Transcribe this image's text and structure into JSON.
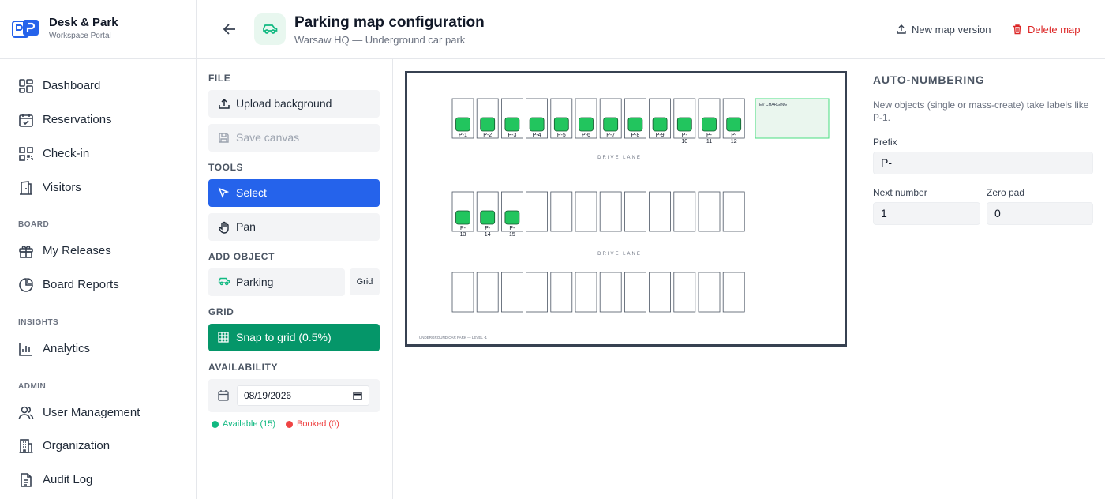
{
  "brand": {
    "name": "Desk & Park",
    "subtitle": "Workspace Portal"
  },
  "sidebar": {
    "items": [
      {
        "label": "Dashboard",
        "icon": "dashboard-icon"
      },
      {
        "label": "Reservations",
        "icon": "calendar-check-icon"
      },
      {
        "label": "Check-in",
        "icon": "qr-code-icon"
      },
      {
        "label": "Visitors",
        "icon": "door-icon"
      }
    ],
    "board_label": "BOARD",
    "board_items": [
      {
        "label": "My Releases",
        "icon": "gift-icon"
      },
      {
        "label": "Board Reports",
        "icon": "pie-chart-icon"
      }
    ],
    "insights_label": "INSIGHTS",
    "insights_items": [
      {
        "label": "Analytics",
        "icon": "bar-chart-icon"
      }
    ],
    "admin_label": "ADMIN",
    "admin_items": [
      {
        "label": "User Management",
        "icon": "users-icon"
      },
      {
        "label": "Organization",
        "icon": "building-icon"
      },
      {
        "label": "Audit Log",
        "icon": "document-icon"
      }
    ]
  },
  "header": {
    "title": "Parking map configuration",
    "subtitle": "Warsaw HQ — Underground car park",
    "new_version_label": "New map version",
    "delete_label": "Delete map"
  },
  "tools": {
    "file_label": "FILE",
    "upload_label": "Upload background",
    "save_label": "Save canvas",
    "tools_label": "TOOLS",
    "select_label": "Select",
    "pan_label": "Pan",
    "add_object_label": "ADD OBJECT",
    "parking_label": "Parking",
    "grid_button_label": "Grid",
    "grid_label": "GRID",
    "snap_label": "Snap to grid (0.5%)",
    "availability_label": "AVAILABILITY",
    "date_value": "08/19/2026",
    "available_label": "Available (15)",
    "booked_label": "Booked (0)",
    "available_color": "#10b981",
    "booked_color": "#ef4444"
  },
  "map": {
    "drive_lane_label": "DRIVE LANE",
    "ev_label": "EV CHARGING",
    "footer_label": "UNDERGROUND CAR PARK — LEVEL -1",
    "row1_labels": [
      "P-1",
      "P-2",
      "P-3",
      "P-4",
      "P-5",
      "P-6",
      "P-7",
      "P-8",
      "P-9",
      "P-10",
      "P-11",
      "P-12"
    ],
    "row2_labels": [
      "P-13",
      "P-14",
      "P-15"
    ],
    "row3_count": 12,
    "available_marker_color": "#22c55e"
  },
  "auto_numbering": {
    "title": "AUTO-NUMBERING",
    "description": "New objects (single or mass-create) take labels like P-1.",
    "prefix_label": "Prefix",
    "prefix_value": "P-",
    "next_label": "Next number",
    "next_value": "1",
    "zero_pad_label": "Zero pad",
    "zero_pad_value": "0"
  }
}
